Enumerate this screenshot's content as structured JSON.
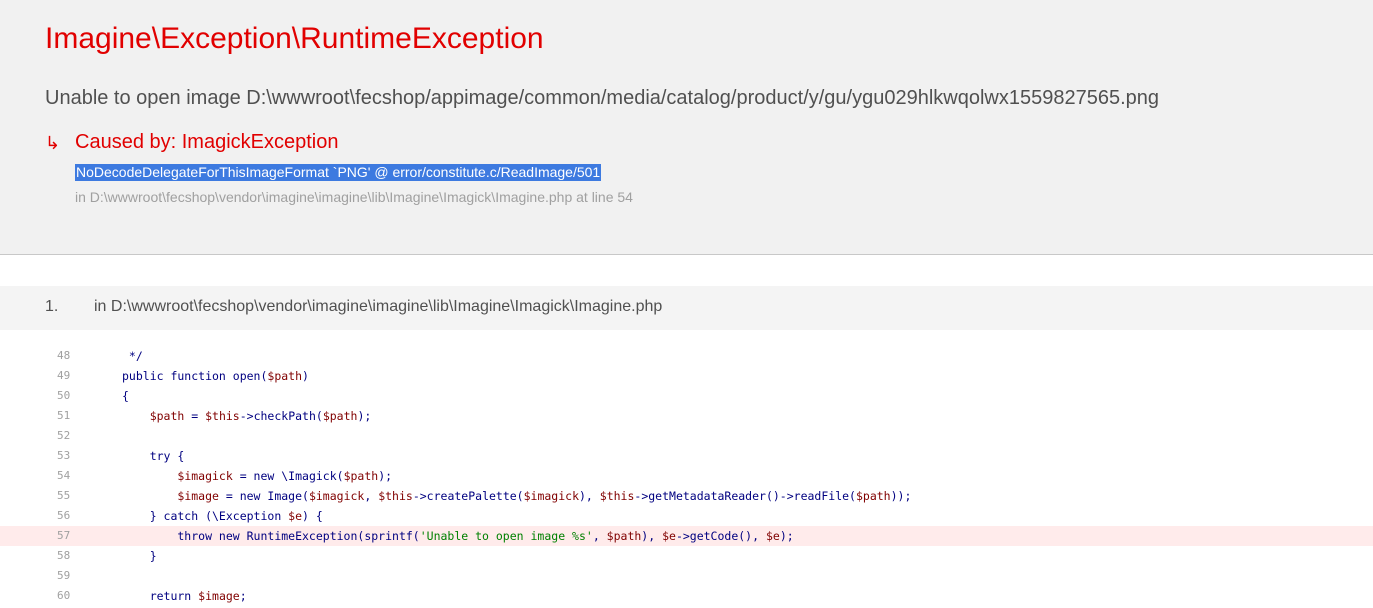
{
  "error": {
    "title": "Imagine\\Exception\\RuntimeException",
    "message": "Unable to open image D:\\wwwroot\\fecshop/appimage/common/media/catalog/product/y/gu/ygu029hlkwqolwx1559827565.png",
    "caused_by": {
      "arrow": "↳",
      "title": "Caused by: ImagickException",
      "message": "NoDecodeDelegateForThisImageFormat `PNG' @ error/constitute.c/ReadImage/501",
      "location": "in D:\\wwwroot\\fecshop\\vendor\\imagine\\imagine\\lib\\Imagine\\Imagick\\Imagine.php at line 54"
    }
  },
  "trace": {
    "number": "1.",
    "file": "in D:\\wwwroot\\fecshop\\vendor\\imagine\\imagine\\lib\\Imagine\\Imagick\\Imagine.php",
    "error_line": "57",
    "lines": [
      {
        "no": "48",
        "code": " */"
      },
      {
        "no": "49",
        "code": "public function open($path)"
      },
      {
        "no": "50",
        "code": "{"
      },
      {
        "no": "51",
        "code": "    $path = $this->checkPath($path);"
      },
      {
        "no": "52",
        "code": ""
      },
      {
        "no": "53",
        "code": "    try {"
      },
      {
        "no": "54",
        "code": "        $imagick = new \\Imagick($path);"
      },
      {
        "no": "55",
        "code": "        $image = new Image($imagick, $this->createPalette($imagick), $this->getMetadataReader()->readFile($path));"
      },
      {
        "no": "56",
        "code": "    } catch (\\Exception $e) {"
      },
      {
        "no": "57",
        "code": "        throw new RuntimeException(sprintf('Unable to open image %s', $path), $e->getCode(), $e);"
      },
      {
        "no": "58",
        "code": "    }"
      },
      {
        "no": "59",
        "code": ""
      },
      {
        "no": "60",
        "code": "    return $image;"
      }
    ]
  },
  "colors": {
    "title_red": "#e10000",
    "header_bg": "#f1f1f1",
    "selection": "#3d7ae0",
    "error_line_bg": "#ffebeb",
    "variable": "#800000",
    "keyword": "#000080",
    "string": "#008000"
  }
}
